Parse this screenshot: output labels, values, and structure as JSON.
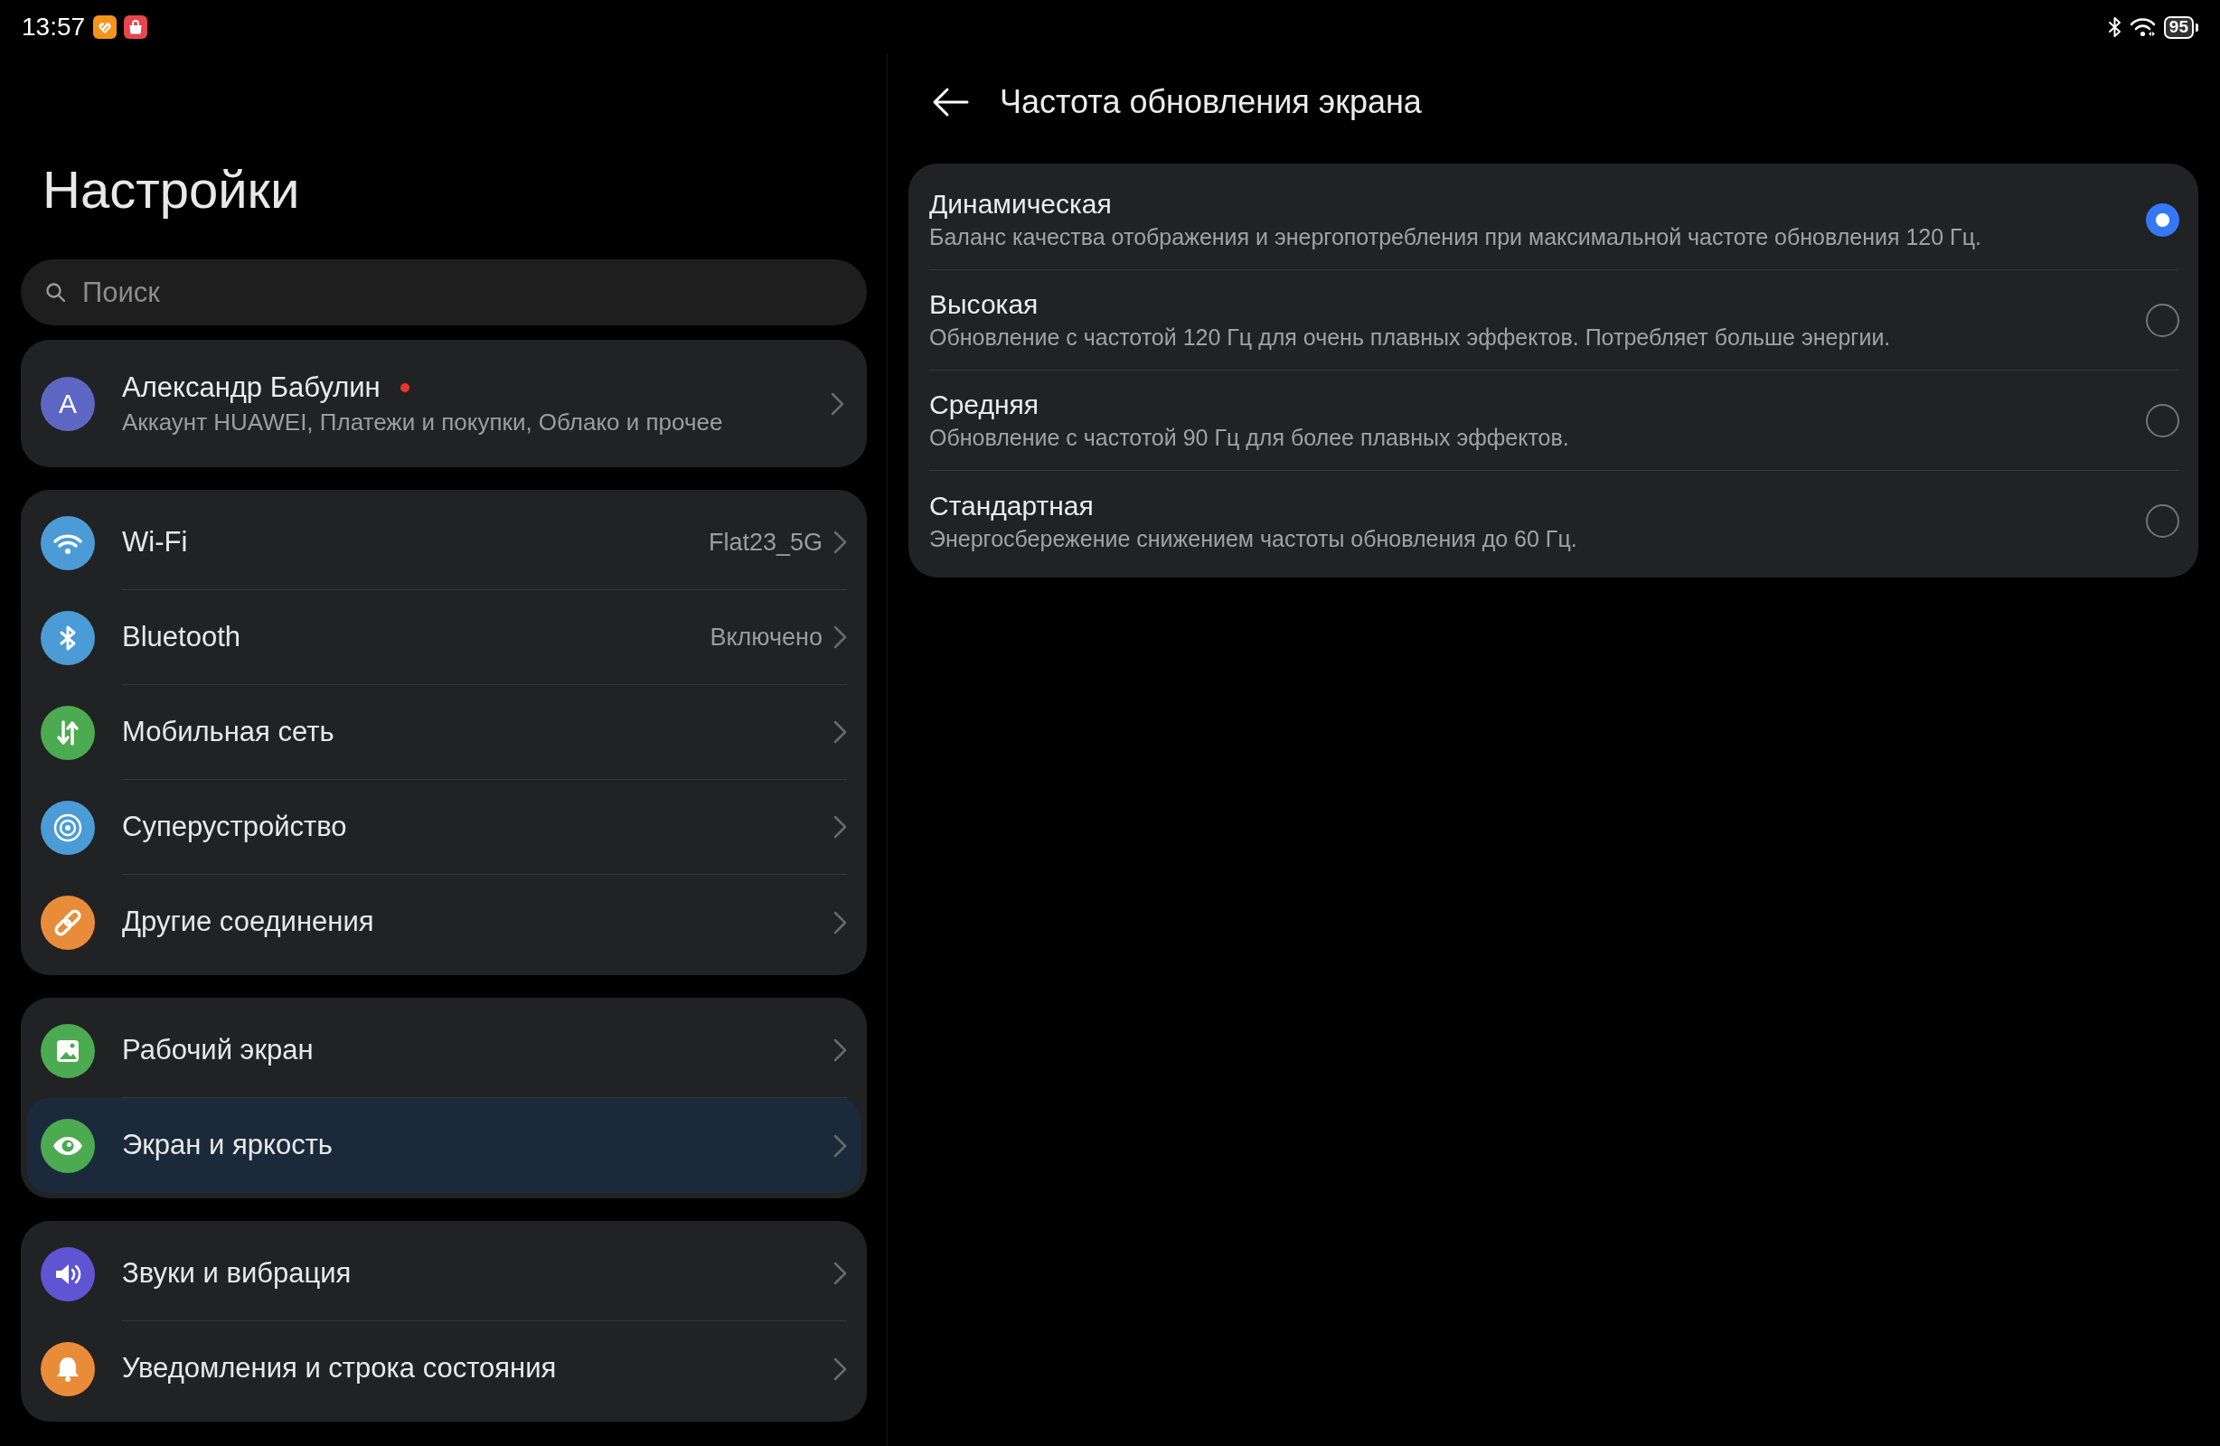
{
  "status_bar": {
    "time": "13:57",
    "battery": "95"
  },
  "sidebar": {
    "title": "Настройки",
    "search": {
      "placeholder": "Поиск"
    },
    "account": {
      "avatar_letter": "А",
      "name": "Александр Бабулин",
      "unread": true,
      "subtitle": "Аккаунт HUAWEI, Платежи и покупки, Облако и прочее"
    },
    "groups": [
      {
        "items": [
          {
            "label": "Wi-Fi",
            "value": "Flat23_5G",
            "color": "#4b9bd6",
            "selected": false
          },
          {
            "label": "Bluetooth",
            "value": "Включено",
            "color": "#4b9bd6",
            "selected": false
          },
          {
            "label": "Мобильная сеть",
            "color": "#4caa50",
            "selected": false
          },
          {
            "label": "Суперустройство",
            "color": "#4b9bd6",
            "selected": false
          },
          {
            "label": "Другие соединения",
            "color": "#e98c3a",
            "selected": false
          }
        ]
      },
      {
        "items": [
          {
            "label": "Рабочий экран",
            "color": "#4caa50",
            "selected": false
          },
          {
            "label": "Экран и яркость",
            "color": "#4caa50",
            "selected": true
          }
        ]
      },
      {
        "items": [
          {
            "label": "Звуки и вибрация",
            "color": "#5f55d2",
            "selected": false
          },
          {
            "label": "Уведомления и строка состояния",
            "color": "#e98c3a",
            "selected": false
          }
        ]
      }
    ]
  },
  "detail": {
    "title": "Частота обновления экрана",
    "options": [
      {
        "title": "Динамическая",
        "description": "Баланс качества отображения и энергопотребления при максимальной частоте обновления 120 Гц.",
        "selected": true
      },
      {
        "title": "Высокая",
        "description": "Обновление с частотой 120 Гц для очень плавных эффектов. Потребляет больше энергии.",
        "selected": false
      },
      {
        "title": "Средняя",
        "description": "Обновление с частотой 90 Гц для более плавных эффектов.",
        "selected": false
      },
      {
        "title": "Стандартная",
        "description": "Энергосбережение снижением частоты обновления до 60 Гц.",
        "selected": false
      }
    ]
  }
}
